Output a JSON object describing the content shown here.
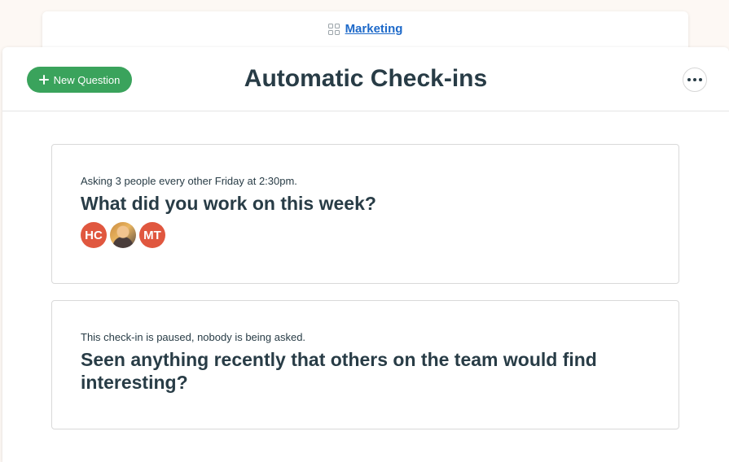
{
  "breadcrumb": {
    "icon": "grid-icon",
    "label": "Marketing"
  },
  "header": {
    "title": "Automatic Check-ins",
    "new_question_label": "New Question",
    "more_icon": "ellipsis-icon"
  },
  "colors": {
    "accent_green": "#3aa35c",
    "link_blue": "#1d69c9",
    "avatar_red": "#e0573f",
    "text_dark": "#283c46"
  },
  "checkins": [
    {
      "status": "Asking 3 people every other Friday at 2:30pm.",
      "question": "What did you work on this week?",
      "avatars": [
        "HC",
        "",
        "MT"
      ]
    },
    {
      "status": "This check-in is paused, nobody is being asked.",
      "question": "Seen anything recently that others on the team would find interesting?"
    }
  ]
}
